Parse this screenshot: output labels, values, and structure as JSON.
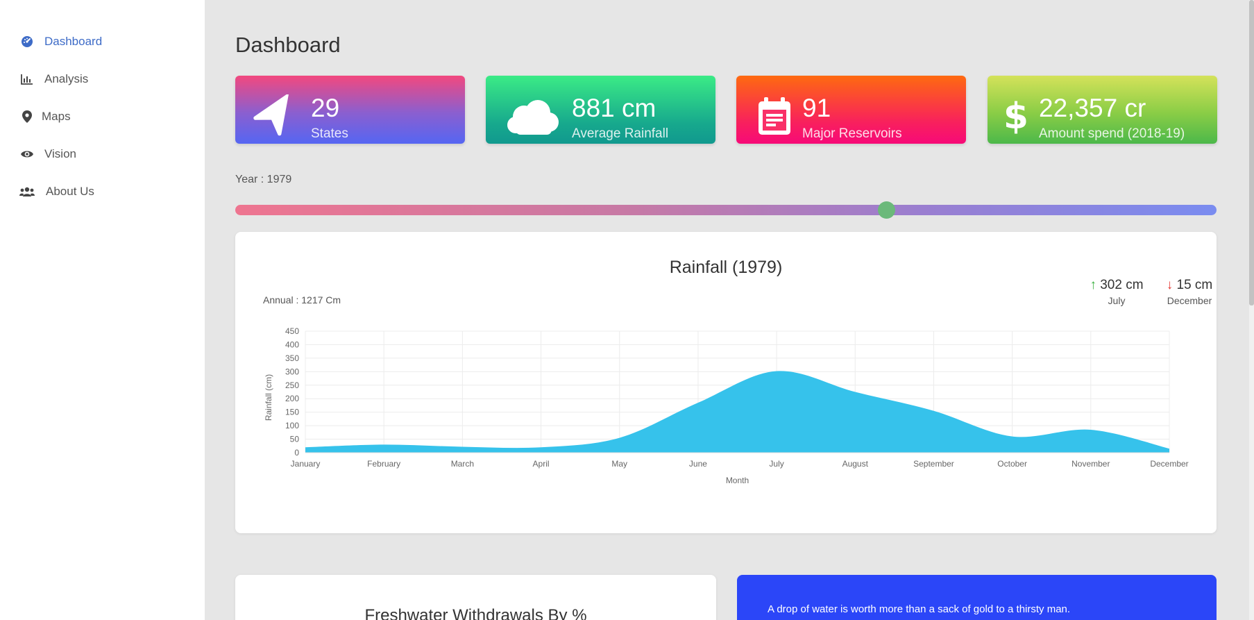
{
  "sidebar": {
    "items": [
      {
        "label": "Dashboard",
        "icon": "gauge-icon",
        "active": true
      },
      {
        "label": "Analysis",
        "icon": "bar-chart-icon"
      },
      {
        "label": "Maps",
        "icon": "map-pin-icon"
      },
      {
        "label": "Vision",
        "icon": "eye-icon"
      },
      {
        "label": "About Us",
        "icon": "users-icon"
      }
    ]
  },
  "page": {
    "title": "Dashboard"
  },
  "cards": [
    {
      "value": "29",
      "label": "States",
      "icon": "navigation-arrow-icon"
    },
    {
      "value": "881 cm",
      "label": "Average Rainfall",
      "icon": "cloud-icon"
    },
    {
      "value": "91",
      "label": "Major Reservoirs",
      "icon": "calendar-icon"
    },
    {
      "value": "22,357 cr",
      "label": "Amount spend (2018-19)",
      "icon": "dollar-icon"
    }
  ],
  "year": {
    "label": "Year : 1979",
    "value": 1979
  },
  "rainfall": {
    "annual": "Annual : 1217 Cm",
    "max": {
      "arrow": "↑",
      "value": "302 cm",
      "month": "July"
    },
    "min": {
      "arrow": "↓",
      "value": "15 cm",
      "month": "December"
    }
  },
  "chart_data": {
    "type": "area",
    "title": "Rainfall (1979)",
    "xlabel": "Month",
    "ylabel": "Rainfall (cm)",
    "categories": [
      "January",
      "February",
      "March",
      "April",
      "May",
      "June",
      "July",
      "August",
      "September",
      "October",
      "November",
      "December"
    ],
    "series": [
      {
        "values": [
          20,
          30,
          22,
          20,
          55,
          185,
          302,
          225,
          155,
          60,
          85,
          15
        ],
        "color": "#36c2eb"
      }
    ],
    "ylim": [
      0,
      450
    ],
    "yticks": [
      0,
      50,
      100,
      150,
      200,
      250,
      300,
      350,
      400,
      450
    ],
    "grid": true
  },
  "bottom": {
    "left_title": "Freshwater Withdrawals By %",
    "quote": "A drop of water is worth more than a sack of gold to a thirsty man."
  },
  "colors": {
    "accent": "#3d6bc7",
    "sidebar": "#ffffff",
    "background": "#e6e6e6",
    "quote_panel": "#2b46f8"
  }
}
